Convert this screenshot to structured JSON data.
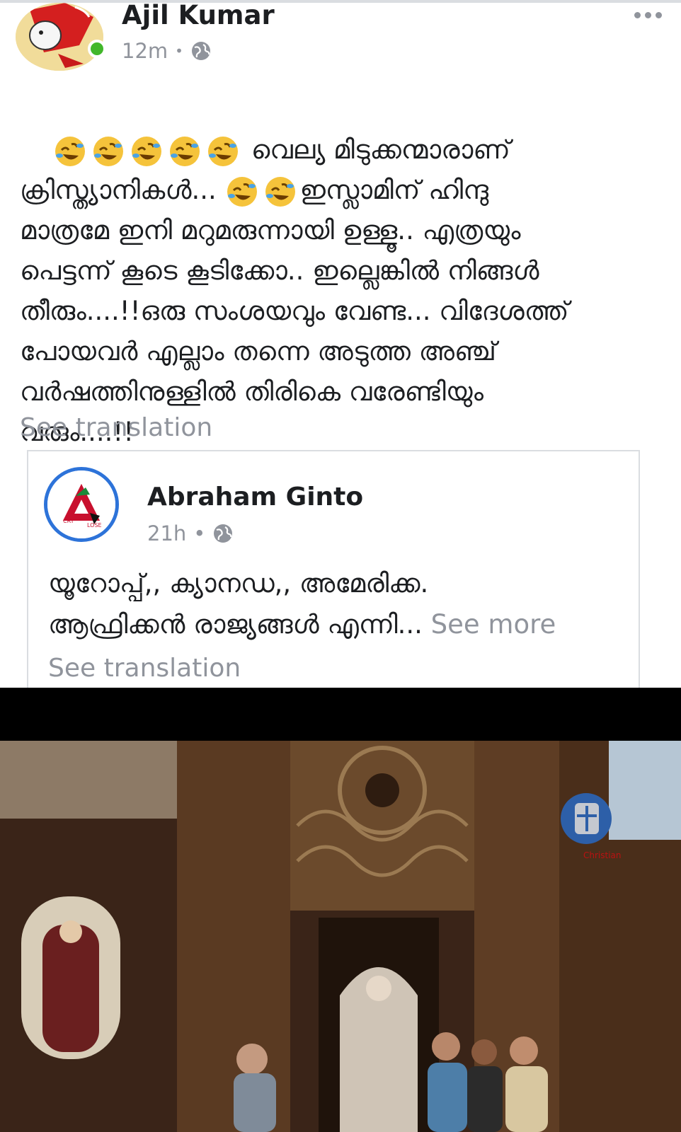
{
  "post": {
    "author": "Ajil Kumar",
    "time": "12m",
    "privacy_icon": "globe-icon",
    "more_icon": "more-dots-icon",
    "emoji_prefix_count": 5,
    "line1": "വെല്യ മിടുക്കന്മാരാണ്",
    "line2a": "ക്രിസ്ത്യാനികൾ...",
    "line2b": "ഇസ്ലാമിന് ഹിന്ദു",
    "line3": "മാത്രമേ ഇനി മറുമരുന്നായി ഉള്ളൂ.. എത്രയും",
    "line4": "പെട്ടന്ന് കൂടെ കൂടിക്കോ.. ഇല്ലെങ്കിൽ നിങ്ങൾ",
    "line5": "തീരും....!!ഒരു സംശയവും വേണ്ട... വിദേശത്ത്",
    "line6": "പോയവർ എല്ലാം തന്നെ അടുത്ത അഞ്ച്",
    "line7": "വർഷത്തിനുള്ളിൽ തിരികെ വരേണ്ടിയും",
    "line8": "വരും....!!",
    "see_translation": "See translation"
  },
  "shared": {
    "author": "Abraham Ginto",
    "time": "21h",
    "line1": "യൂറോപ്പ്,, ക്യാനഡ,, അമേരിക്ക.",
    "line2": "ആഫ്രിക്കൻ രാജ്യങ്ങൾ എന്നി...",
    "see_more": "See more",
    "see_translation": "See translation"
  },
  "video": {
    "watermark_label": "Christian"
  },
  "colors": {
    "secondary_text": "#90949c",
    "online": "#42b72a",
    "avatar_ring": "#2d73d9"
  }
}
